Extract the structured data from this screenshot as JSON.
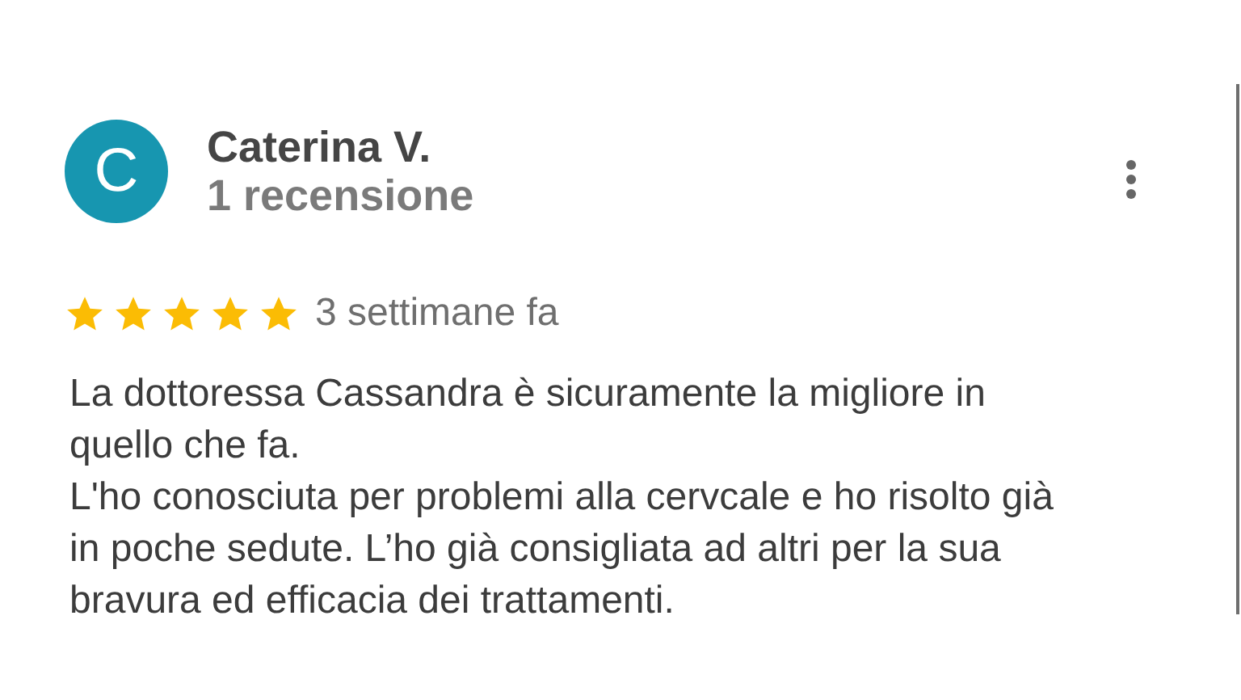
{
  "review": {
    "avatar_letter": "C",
    "author": "Caterina V.",
    "review_count": "1 recensione",
    "stars": 5,
    "date": "3 settimane fa",
    "paragraphs": [
      "La dottoressa Cassandra è sicuramente la migliore in quello che fa.",
      "L'ho conosciuta per problemi alla cervcale e ho risolto già in poche sedute. L’ho già consigliata ad altri per la sua bravura ed efficacia dei trattamenti."
    ]
  }
}
